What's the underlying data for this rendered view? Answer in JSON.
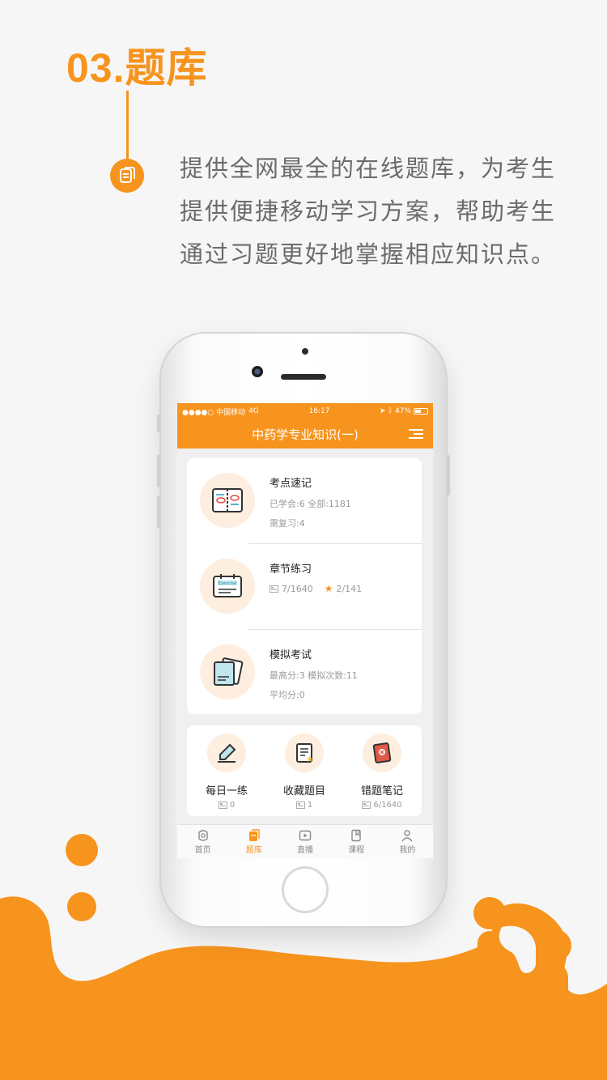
{
  "headline": "03.题库",
  "intro": {
    "lines": [
      "提供全网最全的在线题库，为考生",
      "提供便捷移动学习方案，帮助考生",
      "通过习题更好地掌握相应知识点。"
    ]
  },
  "colors": {
    "accent": "#f7941e",
    "icon_bg": "#fdeee0",
    "text_gray": "#6b6b6b"
  },
  "phone": {
    "status_bar": {
      "carrier": "●●●●○ 中国移动",
      "network": "4G",
      "time": "16:17",
      "battery": "47%"
    },
    "nav": {
      "title": "中药学专业知识(一)",
      "menu_icon": "menu-icon"
    },
    "modules": [
      {
        "icon": "notebook-icon",
        "title": "考点速记",
        "line1": "已学会:6  全部:1181",
        "line2": "需复习:4"
      },
      {
        "icon": "exercise-icon",
        "title": "章节练习",
        "count": "7/1640",
        "starred": "2/141"
      },
      {
        "icon": "exam-icon",
        "title": "模拟考试",
        "line1": "最高分:3  模拟次数:11",
        "line2": "平均分:0"
      }
    ],
    "quick": [
      {
        "icon": "pen-icon",
        "label": "每日一练",
        "count": "0"
      },
      {
        "icon": "favorite-list-icon",
        "label": "收藏题目",
        "count": "1"
      },
      {
        "icon": "error-book-icon",
        "label": "错题笔记",
        "count": "6/1640"
      }
    ],
    "tabs": [
      {
        "icon": "home-icon",
        "label": "首页",
        "active": false
      },
      {
        "icon": "question-bank-icon",
        "label": "题库",
        "active": true
      },
      {
        "icon": "live-icon",
        "label": "直播",
        "active": false
      },
      {
        "icon": "course-icon",
        "label": "课程",
        "active": false
      },
      {
        "icon": "profile-icon",
        "label": "我的",
        "active": false
      }
    ]
  }
}
